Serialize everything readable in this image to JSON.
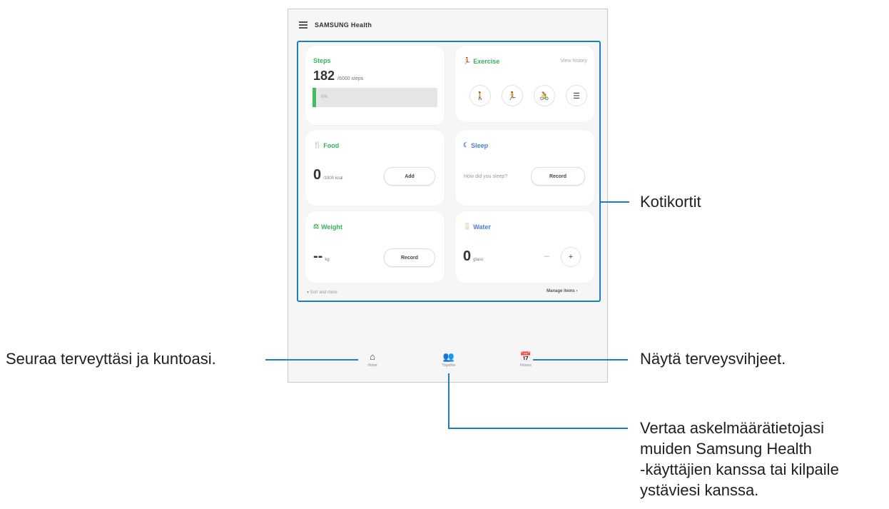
{
  "app": {
    "title": "SAMSUNG Health"
  },
  "cards": {
    "steps": {
      "title": "Steps",
      "value": "182",
      "unit": "/6000 steps",
      "bar_label": "0%",
      "progress_fraction": 0.03
    },
    "exercise": {
      "title": "Exercise",
      "history": "View history",
      "icons": [
        "walking-icon",
        "running-icon",
        "cycling-icon",
        "list-icon"
      ],
      "glyphs": [
        "🚶",
        "🏃",
        "🚴",
        "☰"
      ]
    },
    "food": {
      "title": "Food",
      "value": "0",
      "unit": "/1900 kcal",
      "button": "Add"
    },
    "sleep": {
      "title": "Sleep",
      "question": "How did you sleep?",
      "button": "Record"
    },
    "weight": {
      "title": "Weight",
      "value": "--",
      "unit": "kg",
      "button": "Record"
    },
    "water": {
      "title": "Water",
      "value": "0",
      "unit": "glass",
      "minus": "–",
      "plus": "+"
    }
  },
  "footer": {
    "left": "▾ Sort and more",
    "right": "Manage items ›"
  },
  "nav": [
    {
      "label": "Home",
      "glyph": "⌂",
      "icon": "home-icon"
    },
    {
      "label": "Together",
      "glyph": "👥",
      "icon": "people-icon"
    },
    {
      "label": "Fitness",
      "glyph": "📅",
      "icon": "calendar-icon"
    }
  ],
  "callouts": {
    "home_cards": "Kotikortit",
    "track": "Seuraa terveyttäsi ja kuntoasi.",
    "tips": "Näytä terveysvihjeet.",
    "compare": "Vertaa askelmäärätietojasi\nmuiden Samsung Health\n-käyttäjien kanssa tai kilpaile\nystäviesi kanssa."
  },
  "colors": {
    "accent": "#1a7ec0",
    "green": "#36b35a",
    "blue": "#4a7fd6"
  }
}
